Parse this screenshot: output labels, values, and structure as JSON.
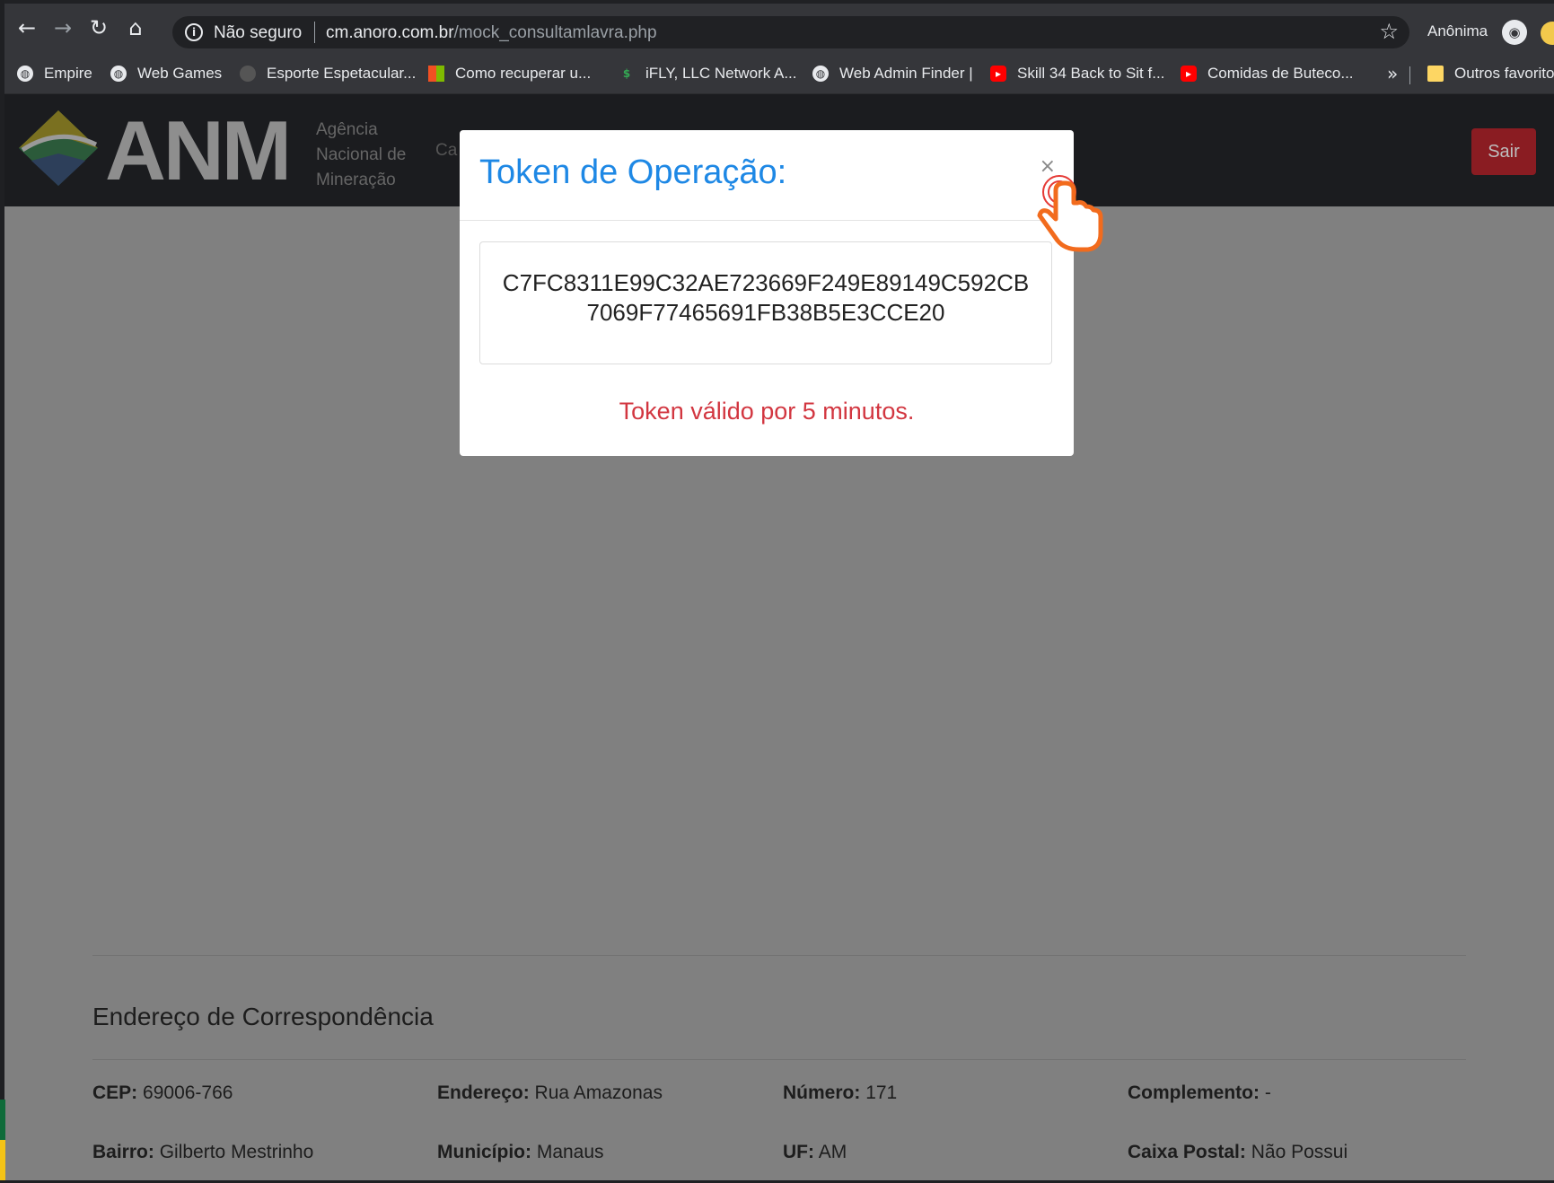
{
  "browser": {
    "security_label": "Não seguro",
    "url_host": "cm.anoro.com.br",
    "url_path": "/mock_consultamlavra.php",
    "profile_label": "Anônima",
    "bookmarks": [
      {
        "label": "Empire",
        "icon": "globe-icon"
      },
      {
        "label": "Web Games",
        "icon": "globe-icon"
      },
      {
        "label": "Esporte Espetacular...",
        "icon": "site-icon"
      },
      {
        "label": "Como recuperar u...",
        "icon": "microsoft-icon"
      },
      {
        "label": "iFLY, LLC Network A...",
        "icon": "ifly-icon"
      },
      {
        "label": "Web Admin Finder |",
        "icon": "globe-icon"
      },
      {
        "label": "Skill 34 Back to Sit f...",
        "icon": "youtube-icon"
      },
      {
        "label": "Comidas de Buteco...",
        "icon": "youtube-icon"
      }
    ],
    "bookmarks_more": "»",
    "other_bookmarks": "Outros favoritos"
  },
  "site": {
    "logo_text": "ANM",
    "logo_sub": [
      "Agência",
      "Nacional de",
      "Mineração"
    ],
    "nav_peek": "Ca",
    "logout_label": "Sair"
  },
  "modal": {
    "title": "Token de Operação:",
    "close_symbol": "×",
    "token_lines": [
      "C7FC8311E99C32AE723669F249E89149C592CB",
      "7069F77465691FB38B5E3CCE20"
    ],
    "validity": "Token válido por 5 minutos."
  },
  "address": {
    "title": "Endereço de Correspondência",
    "fields": [
      {
        "key": "CEP:",
        "value": "69006-766"
      },
      {
        "key": "Endereço:",
        "value": "Rua Amazonas"
      },
      {
        "key": "Número:",
        "value": "171"
      },
      {
        "key": "Complemento:",
        "value": "-"
      },
      {
        "key": "Bairro:",
        "value": "Gilberto Mestrinho"
      },
      {
        "key": "Município:",
        "value": "Manaus"
      },
      {
        "key": "UF:",
        "value": "AM"
      },
      {
        "key": "Caixa Postal:",
        "value": "Não Possui"
      }
    ]
  },
  "colors": {
    "modal_title": "#1e88e5",
    "validity_text": "#d23640",
    "logout_button": "#8a1c22",
    "overlay": "#808080"
  }
}
